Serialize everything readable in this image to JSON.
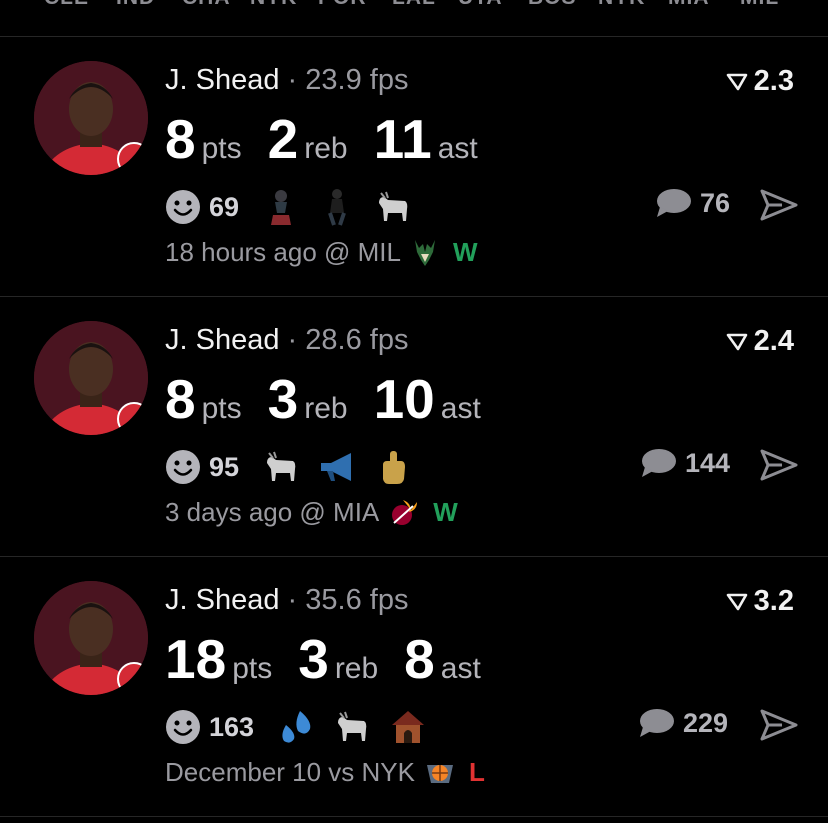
{
  "tabs": [
    "CLE",
    "IND",
    "CHA",
    "NYK",
    "POR",
    "LAL",
    "UTA",
    "BOS",
    "NYK",
    "MIA",
    "MIL"
  ],
  "colors": {
    "background": "#000000",
    "win": "#22a05b",
    "loss": "#e03232",
    "secondary_text": "#9a9aa0",
    "jersey_red": "#d42a35"
  },
  "cards": [
    {
      "player": "J. Shead",
      "sep": "·",
      "fps": "23.9 fps",
      "rating": "2.3",
      "stats": [
        {
          "num": "8",
          "unit": "pts"
        },
        {
          "num": "2",
          "unit": "reb"
        },
        {
          "num": "11",
          "unit": "ast"
        }
      ],
      "reaction_count": "69",
      "reaction_icons": [
        "person-icon",
        "dancer-icon",
        "goat-icon"
      ],
      "comments": "76",
      "time": "18 hours ago @ MIL",
      "opponent_logo": "bucks-logo-icon",
      "result": "W"
    },
    {
      "player": "J. Shead",
      "sep": "·",
      "fps": "28.6 fps",
      "rating": "2.4",
      "stats": [
        {
          "num": "8",
          "unit": "pts"
        },
        {
          "num": "3",
          "unit": "reb"
        },
        {
          "num": "10",
          "unit": "ast"
        }
      ],
      "reaction_count": "95",
      "reaction_icons": [
        "goat-icon",
        "megaphone-icon",
        "middle-finger-icon"
      ],
      "comments": "144",
      "time": "3 days ago @ MIA",
      "opponent_logo": "heat-logo-icon",
      "result": "W"
    },
    {
      "player": "J. Shead",
      "sep": "·",
      "fps": "35.6 fps",
      "rating": "3.2",
      "stats": [
        {
          "num": "18",
          "unit": "pts"
        },
        {
          "num": "3",
          "unit": "reb"
        },
        {
          "num": "8",
          "unit": "ast"
        }
      ],
      "reaction_count": "163",
      "reaction_icons": [
        "sweat-drops-icon",
        "goat-icon",
        "doghouse-icon"
      ],
      "comments": "229",
      "time": "December 10 vs NYK",
      "opponent_logo": "knicks-logo-icon",
      "result": "L"
    }
  ]
}
